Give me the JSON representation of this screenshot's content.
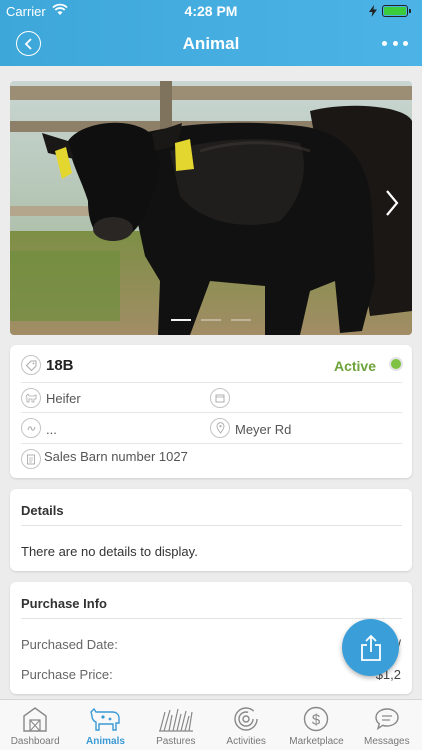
{
  "status_bar": {
    "carrier": "Carrier",
    "time": "4:28 PM"
  },
  "nav": {
    "title": "Animal"
  },
  "gallery": {
    "slide_count": 3,
    "active_slide": 1
  },
  "animal": {
    "tag": "18B",
    "status": "Active",
    "status_color": "#7ec143",
    "type": "Heifer",
    "breed": "...",
    "location": "Meyer Rd",
    "note": "Sales Barn number 1027"
  },
  "details": {
    "title": "Details",
    "empty_text": "There are no details to display."
  },
  "purchase": {
    "title": "Purchase Info",
    "date_label": "Purchased Date:",
    "date_value": "/",
    "price_label": "Purchase Price:",
    "price_value": "$1,2"
  },
  "tabs": [
    {
      "label": "Dashboard",
      "icon": "barn-icon"
    },
    {
      "label": "Animals",
      "icon": "cow-icon"
    },
    {
      "label": "Pastures",
      "icon": "grass-icon"
    },
    {
      "label": "Activities",
      "icon": "activity-ring-icon"
    },
    {
      "label": "Marketplace",
      "icon": "dollar-icon"
    },
    {
      "label": "Messages",
      "icon": "chat-icon"
    }
  ],
  "active_tab": "Animals",
  "colors": {
    "header": "#43ade0",
    "accent": "#3b9ad6",
    "active_status": "#6da33a",
    "fab": "#3a9fd9"
  }
}
